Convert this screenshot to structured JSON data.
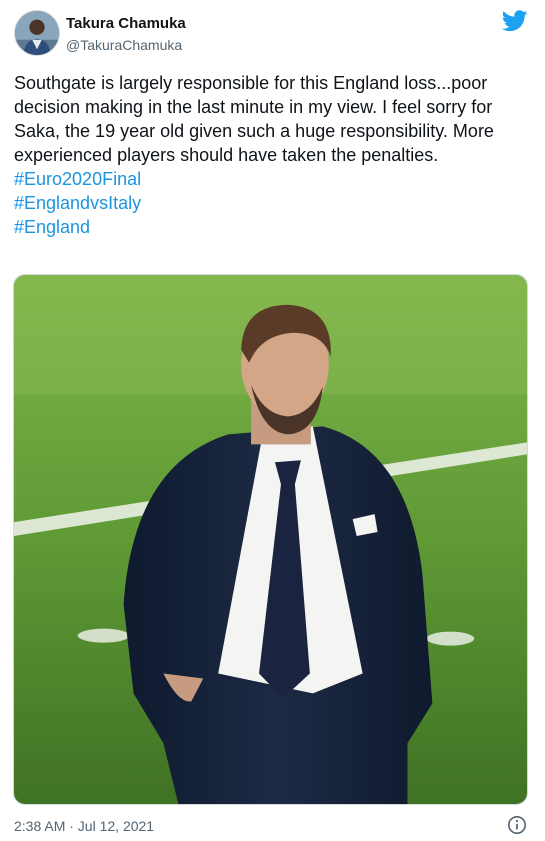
{
  "author": {
    "name": "Takura Chamuka",
    "handle": "@TakuraChamuka"
  },
  "tweet": {
    "text": "Southgate is largely responsible for this England loss...poor decision making in the last minute in my view. I feel sorry for Saka, the 19 year old given such a huge responsibility. More experienced players should have taken the penalties.",
    "hashtags": [
      "#Euro2020Final",
      "#EnglandvsItaly",
      "#England"
    ]
  },
  "timestamp": "2:38 AM · Jul 12, 2021",
  "icons": {
    "brand": "twitter-bird-icon",
    "info": "info-icon"
  },
  "colors": {
    "link": "#1b95e0",
    "brand": "#1da1f2",
    "secondary_text": "#536471"
  }
}
